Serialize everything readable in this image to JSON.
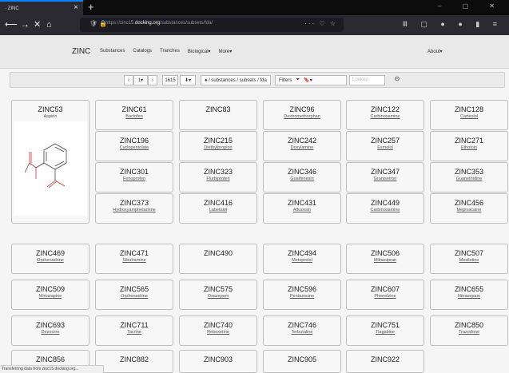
{
  "browser": {
    "tab_title": "· ZINC",
    "url_prefix": "https://zinc15.",
    "url_domain": "docking.org",
    "url_path": "/substances/subsets/fda/",
    "url_more": "···"
  },
  "site": {
    "brand": "ZINC",
    "nav": [
      "Substances",
      "Catalogs",
      "Tranches",
      "Biological▾",
      "More▾"
    ],
    "about": "About▾"
  },
  "toolbar": {
    "prev": "‹",
    "page": "1▾",
    "next": "›",
    "count": "1615",
    "download": "⬇▾",
    "breadcrumb": "♠ / substances / subsets / fda",
    "filters_label": "Filters",
    "filters_extra": "🔖▾",
    "search_placeholder": "Lookup",
    "target_icon": "⊙"
  },
  "compounds": [
    {
      "id": "ZINC53",
      "name": "Aspirin"
    },
    {
      "id": "ZINC61",
      "name": "Baclofen"
    },
    {
      "id": "ZINC83",
      "name": ""
    },
    {
      "id": "ZINC96",
      "name": "Dextromethorphan"
    },
    {
      "id": "ZINC122",
      "name": "Carbinoxamine"
    },
    {
      "id": "ZINC128",
      "name": "Carteolol"
    },
    {
      "id": "ZINC196",
      "name": "Cyclopentolate"
    },
    {
      "id": "ZINC215",
      "name": "Diethylpropion"
    },
    {
      "id": "ZINC242",
      "name": "Doxylamine"
    },
    {
      "id": "ZINC257",
      "name": "Esmolol"
    },
    {
      "id": "ZINC271",
      "name": "Ethotoin"
    },
    {
      "id": "ZINC301",
      "name": "Fenoprofen"
    },
    {
      "id": "ZINC323",
      "name": "Flurbiprofen"
    },
    {
      "id": "ZINC346",
      "name": "Guaifenesin"
    },
    {
      "id": "ZINC347",
      "name": "Granisetron"
    },
    {
      "id": "ZINC353",
      "name": "Guanethidine"
    },
    {
      "id": "ZINC373",
      "name": "Hydroxyamphetamine"
    },
    {
      "id": "ZINC416",
      "name": "Labetalol"
    },
    {
      "id": "ZINC431",
      "name": "Alfuzosin"
    },
    {
      "id": "ZINC449",
      "name": "Carbinoxamine"
    },
    {
      "id": "ZINC456",
      "name": "Mepivacaine"
    },
    {
      "id": "ZINC469",
      "name": "Orphenadrine"
    },
    {
      "id": "ZINC471",
      "name": "Sibutramine"
    },
    {
      "id": "ZINC490",
      "name": ""
    },
    {
      "id": "ZINC494",
      "name": "Metoprolol"
    },
    {
      "id": "ZINC506",
      "name": "Milnacipran"
    },
    {
      "id": "ZINC507",
      "name": "Mexiletine"
    },
    {
      "id": "ZINC509",
      "name": "Mirtazapine"
    },
    {
      "id": "ZINC565",
      "name": "Orphenadrine"
    },
    {
      "id": "ZINC575",
      "name": "Oxazepam"
    },
    {
      "id": "ZINC596",
      "name": "Pentazocine"
    },
    {
      "id": "ZINC607",
      "name": "Phenelzine"
    },
    {
      "id": "ZINC655",
      "name": "Nitrazepam"
    },
    {
      "id": "ZINC693",
      "name": "Dezocine"
    },
    {
      "id": "ZINC711",
      "name": "Tacrine"
    },
    {
      "id": "ZINC740",
      "name": "Reboxetine"
    },
    {
      "id": "ZINC746",
      "name": "Terbutaline"
    },
    {
      "id": "ZINC751",
      "name": "Tiagabine"
    },
    {
      "id": "ZINC850",
      "name": "Trazodone"
    },
    {
      "id": "ZINC856",
      "name": ""
    },
    {
      "id": "ZINC882",
      "name": ""
    },
    {
      "id": "ZINC903",
      "name": ""
    },
    {
      "id": "ZINC905",
      "name": ""
    },
    {
      "id": "ZINC922",
      "name": ""
    }
  ],
  "status_text": "Transferring data from zinc15.docking.org..."
}
